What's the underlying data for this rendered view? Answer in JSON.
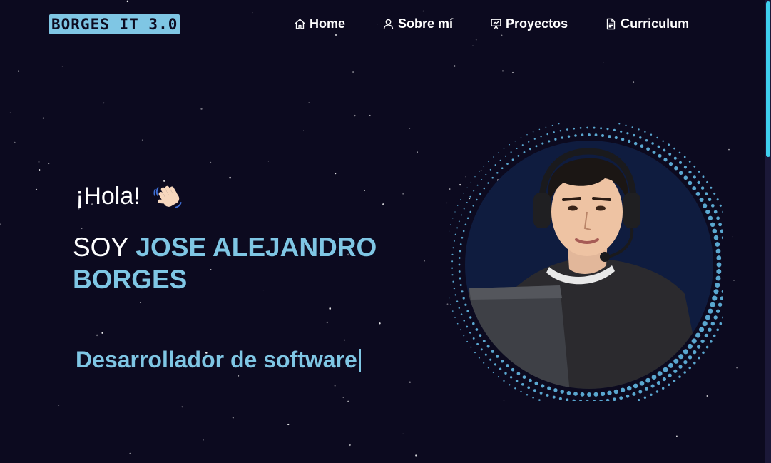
{
  "navbar": {
    "logo": "BORGES IT 3.0",
    "links": [
      {
        "label": "Home",
        "icon": "home-icon"
      },
      {
        "label": "Sobre mí",
        "icon": "user-icon"
      },
      {
        "label": "Proyectos",
        "icon": "presentation-icon"
      },
      {
        "label": "Curriculum",
        "icon": "document-icon"
      }
    ]
  },
  "hero": {
    "greeting": "¡Hola!",
    "greeting_emoji": "waving-hand-icon",
    "intro_prefix": "SOY",
    "name": "JOSE ALEJANDRO BORGES",
    "typed_text": "Desarrollador de software"
  },
  "colors": {
    "background": "#0c0a1f",
    "accent": "#7fc6e4",
    "scrollbar_thumb": "#3fd0ee",
    "avatar_bg": "#0f1c3f"
  }
}
